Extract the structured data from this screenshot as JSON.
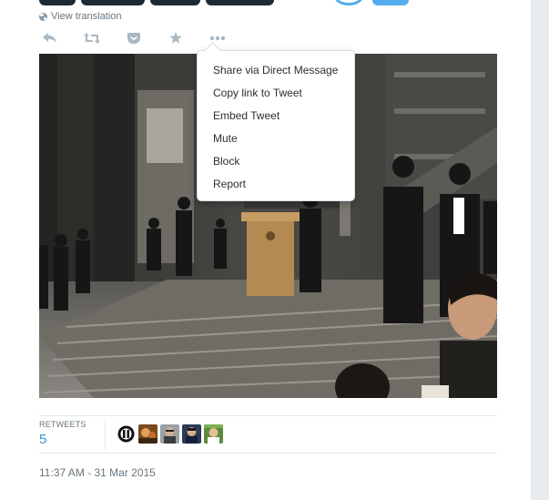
{
  "translation": {
    "link_label": "View translation",
    "icon": "globe-icon"
  },
  "actions": [
    {
      "name": "reply-icon"
    },
    {
      "name": "retweet-icon"
    },
    {
      "name": "favorite-icon"
    },
    {
      "name": "star-icon"
    },
    {
      "name": "more-icon"
    }
  ],
  "menu": {
    "items": [
      {
        "label": "Share via Direct Message"
      },
      {
        "label": "Copy link to Tweet"
      },
      {
        "label": "Embed Tweet"
      },
      {
        "label": "Mute"
      },
      {
        "label": "Block"
      },
      {
        "label": "Report"
      }
    ]
  },
  "stats": {
    "retweets_label": "RETWEETS",
    "retweets_count": "5"
  },
  "timestamp": "11:37 AM - 31 Mar 2015",
  "colors": {
    "accent": "#3b94d9",
    "muted_text": "#66757f",
    "icon_gray": "#aab8c2",
    "border": "#e1e8ed"
  }
}
